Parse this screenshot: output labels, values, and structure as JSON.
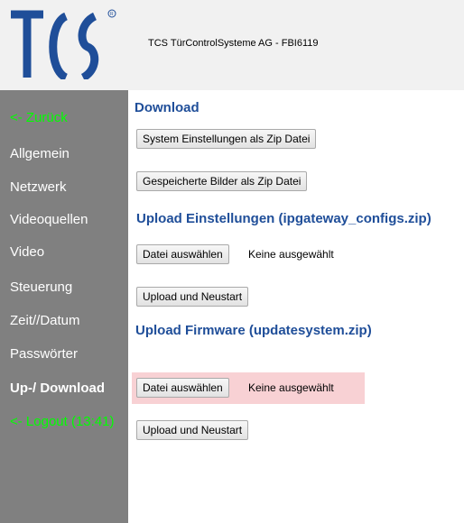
{
  "header": {
    "logo_text": "TCS",
    "title": "TCS TürControlSysteme AG - FBI6119"
  },
  "sidebar": {
    "items": [
      {
        "label": "<- Zurück"
      },
      {
        "label": "Allgemein"
      },
      {
        "label": "Netzwerk"
      },
      {
        "label": "Videoquellen"
      },
      {
        "label": "Video"
      },
      {
        "label": "Steuerung"
      },
      {
        "label": "Zeit//Datum"
      },
      {
        "label": "Passwörter"
      },
      {
        "label": "Up-/ Download"
      },
      {
        "label": "<- Logout (13:41)"
      }
    ],
    "active_item": "Up-/ Download",
    "link_color": "#00ff00",
    "background_color": "#808080"
  },
  "main": {
    "download": {
      "heading": "Download",
      "system_settings_button": "System Einstellungen als Zip Datei",
      "saved_images_button": "Gespeicherte Bilder als Zip Datei"
    },
    "upload_settings": {
      "heading": "Upload Einstellungen (ipgateway_configs.zip)",
      "choose_file_button": "Datei auswählen",
      "no_file_text": "Keine ausgewählt",
      "upload_button": "Upload und Neustart"
    },
    "upload_firmware": {
      "heading": "Upload Firmware (updatesystem.zip)",
      "choose_file_button": "Datei auswählen",
      "no_file_text": "Keine ausgewählt",
      "upload_button": "Upload und Neustart",
      "highlight_color": "#f8d1d4"
    },
    "heading_color": "#1f4e99"
  }
}
